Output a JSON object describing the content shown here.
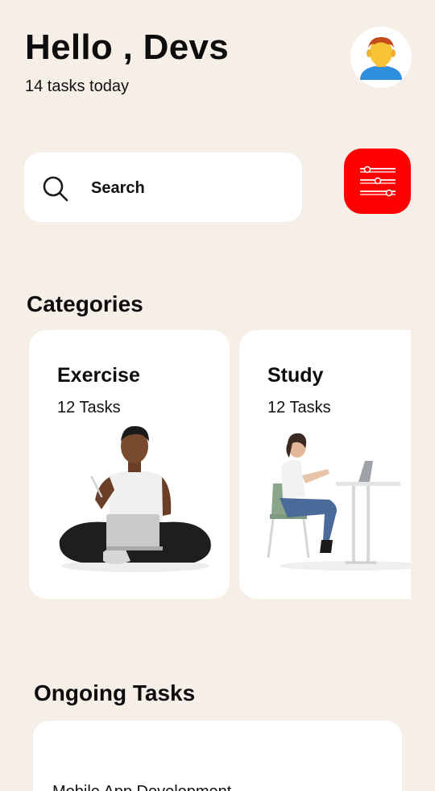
{
  "header": {
    "greeting": "Hello , Devs",
    "subtitle": "14 tasks today",
    "avatar_icon": "person-avatar-icon"
  },
  "search": {
    "label": "Search",
    "icon": "search-icon"
  },
  "filter": {
    "icon": "sliders-icon",
    "color": "#ff0000"
  },
  "categories": {
    "title": "Categories",
    "items": [
      {
        "title": "Exercise",
        "count": "12 Tasks",
        "illustration": "person-with-laptop"
      },
      {
        "title": "Study",
        "count": "12 Tasks",
        "illustration": "person-at-desk"
      }
    ]
  },
  "ongoing": {
    "title": "Ongoing Tasks",
    "tasks": [
      {
        "name": "Mobile App Development"
      }
    ]
  },
  "colors": {
    "background": "#f6efe8",
    "card": "#ffffff",
    "accent": "#ff0000"
  }
}
